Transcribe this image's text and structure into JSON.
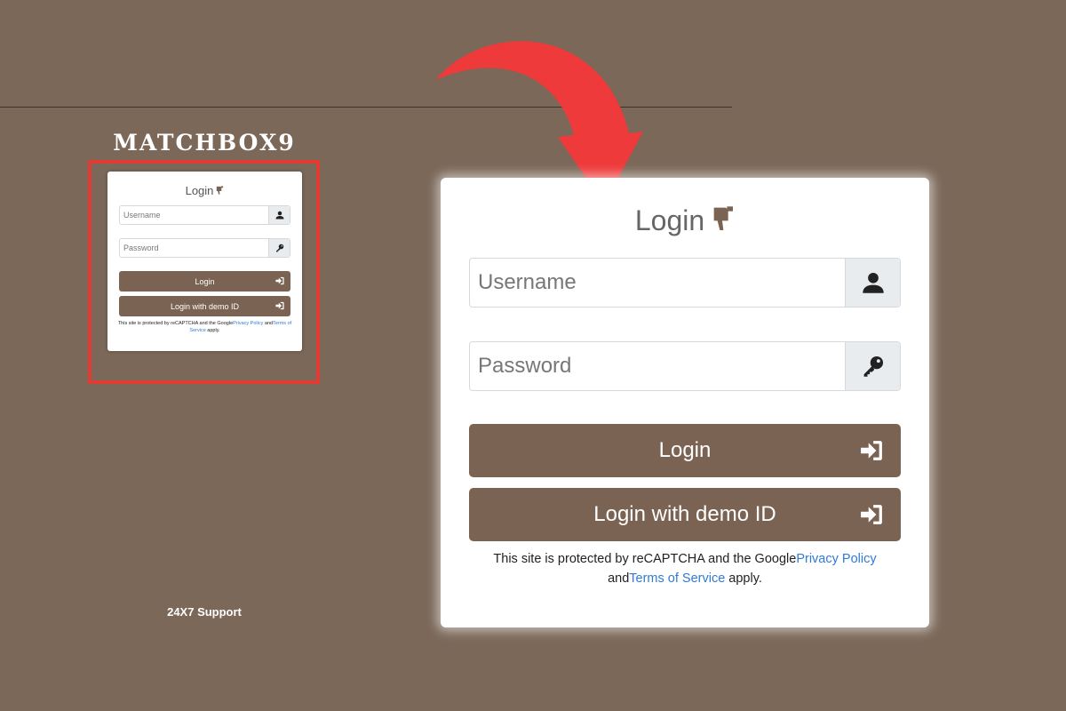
{
  "brand": {
    "name": "MATCHBOX9"
  },
  "login": {
    "title": "Login",
    "username_placeholder": "Username",
    "password_placeholder": "Password",
    "login_label": "Login",
    "demo_label": "Login with demo ID",
    "recaptcha_prefix": "This site is protected by reCAPTCHA and the Google",
    "privacy_link": "Privacy Policy",
    "and_text": " and",
    "terms_link": "Terms of Service",
    "apply_text": " apply."
  },
  "footer": {
    "support": "24X7 Support"
  },
  "colors": {
    "background": "#7b6859",
    "button": "#7b6353",
    "link": "#2f7bd6",
    "highlight": "#e23b34",
    "arrow": "#ee3a3a"
  },
  "icons": {
    "title": "thumbs-down-icon",
    "username": "user-icon",
    "password": "key-icon",
    "button": "sign-in-icon"
  }
}
